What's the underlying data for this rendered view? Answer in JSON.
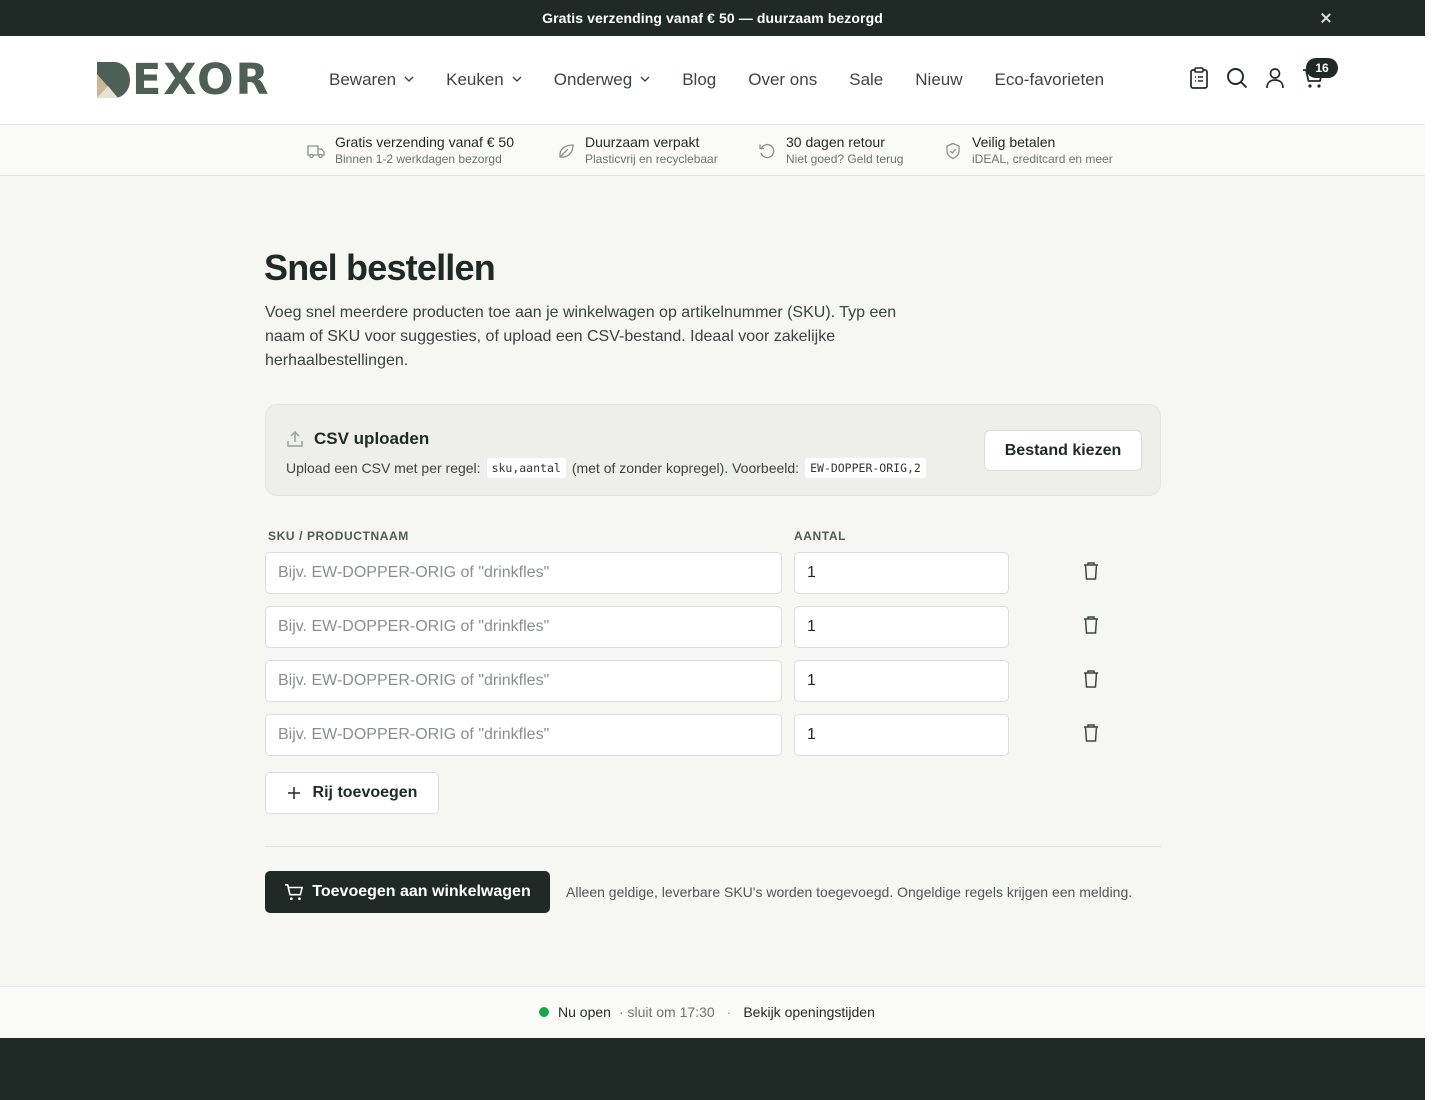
{
  "announcement": {
    "text": "Gratis verzending vanaf € 50 — duurzaam bezorgd"
  },
  "brand": {
    "name": "EXOR",
    "color": "#4d5f56"
  },
  "nav": {
    "items": [
      {
        "label": "Bewaren",
        "dropdown": true
      },
      {
        "label": "Keuken",
        "dropdown": true
      },
      {
        "label": "Onderweg",
        "dropdown": true
      },
      {
        "label": "Blog",
        "dropdown": false
      },
      {
        "label": "Over ons",
        "dropdown": false
      },
      {
        "label": "Sale",
        "dropdown": false
      },
      {
        "label": "Nieuw",
        "dropdown": false
      },
      {
        "label": "Eco-favorieten",
        "dropdown": false
      }
    ]
  },
  "header_icons": [
    "clipboard-list-icon",
    "search-icon",
    "user-icon",
    "cart-icon"
  ],
  "cart": {
    "count": "16"
  },
  "usps": [
    {
      "icon": "truck-icon",
      "title": "Gratis verzending vanaf € 50",
      "sub": "Binnen 1-2 werkdagen bezorgd"
    },
    {
      "icon": "leaf-icon",
      "title": "Duurzaam verpakt",
      "sub": "Plasticvrij en recyclebaar"
    },
    {
      "icon": "return-icon",
      "title": "30 dagen retour",
      "sub": "Niet goed? Geld terug"
    },
    {
      "icon": "shield-check-icon",
      "title": "Veilig betalen",
      "sub": "iDEAL, creditcard en meer"
    }
  ],
  "page": {
    "title": "Snel bestellen",
    "intro": "Voeg snel meerdere producten toe aan je winkelwagen op artikelnummer (SKU). Typ een naam of SKU voor suggesties, of upload een CSV-bestand. Ideaal voor zakelijke herhaalbestellingen."
  },
  "csv": {
    "title": "CSV uploaden",
    "desc_prefix": "Upload een CSV met per regel:",
    "format_code": "sku,aantal",
    "desc_middle": "(met of zonder kopregel). Voorbeeld:",
    "example_code": "EW-DOPPER-ORIG,2",
    "button_label": "Bestand kiezen"
  },
  "table": {
    "sku_header": "SKU / PRODUCTNAAM",
    "qty_header": "AANTAL",
    "sku_placeholder": "Bijv. EW-DOPPER-ORIG of \"drinkfles\"",
    "rows": [
      {
        "sku": "",
        "qty": "1"
      },
      {
        "sku": "",
        "qty": "1"
      },
      {
        "sku": "",
        "qty": "1"
      },
      {
        "sku": "",
        "qty": "1"
      }
    ],
    "add_row_label": "Rij toevoegen"
  },
  "submit": {
    "label": "Toevoegen aan winkelwagen",
    "note": "Alleen geldige, leverbare SKU's worden toegevoegd. Ongeldige regels krijgen een melding."
  },
  "store_status": {
    "open_label": "Nu open",
    "closes": "· sluit om 17:30",
    "separator": "·",
    "hours_link": "Bekijk openingstijden",
    "dot_color": "#1aa64a"
  }
}
